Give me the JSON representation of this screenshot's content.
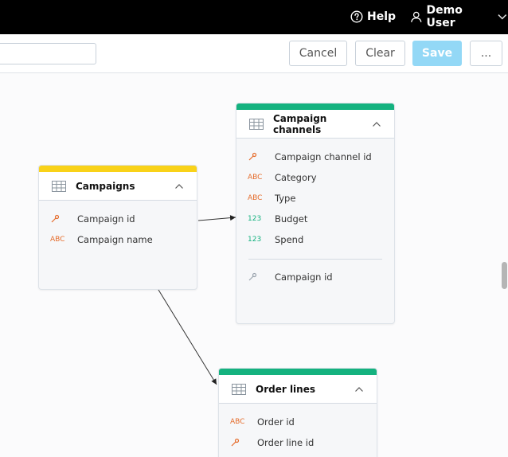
{
  "topbar": {
    "help_label": "Help",
    "user_label": "Demo User"
  },
  "toolbar": {
    "name_value": "",
    "cancel_label": "Cancel",
    "clear_label": "Clear",
    "save_label": "Save",
    "more_label": "..."
  },
  "colors": {
    "attribute_bar": "#f9d219",
    "fact_bar": "#14b27f",
    "save_button": "#93d8f6",
    "abc_icon": "#e56c2b",
    "numeric_icon": "#14b27f"
  },
  "datasets": {
    "campaigns": {
      "title": "Campaigns",
      "fields": [
        {
          "icon": "key-icon",
          "label": "Campaign id"
        },
        {
          "icon": "ABC",
          "label": "Campaign name"
        }
      ]
    },
    "campaign_channels": {
      "title": "Campaign channels",
      "fields": [
        {
          "icon": "key-icon",
          "label": "Campaign channel id"
        },
        {
          "icon": "ABC",
          "label": "Category"
        },
        {
          "icon": "ABC",
          "label": "Type"
        },
        {
          "icon": "123",
          "label": "Budget"
        },
        {
          "icon": "123",
          "label": "Spend"
        }
      ],
      "references": [
        {
          "icon": "reference-key-icon",
          "label": "Campaign id"
        }
      ]
    },
    "order_lines": {
      "title": "Order lines",
      "fields": [
        {
          "icon": "ABC",
          "label": "Order id"
        },
        {
          "icon": "key-icon",
          "label": "Order line id"
        }
      ]
    }
  }
}
